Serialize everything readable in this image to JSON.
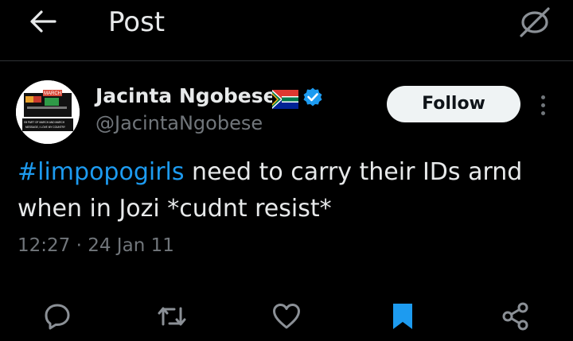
{
  "header": {
    "title": "Post",
    "back_icon": "arrow-left-icon",
    "grok_icon": "grok-icon"
  },
  "author": {
    "name": "Jacinta Ngobese",
    "handle": "@JacintaNgobese",
    "flag_icon": "south-africa-flag-icon",
    "verified_icon": "verified-badge-icon",
    "verified_color": "#1d9bf0",
    "avatar": {
      "logo_text": "MARCH",
      "tagline_1": "I'M PART OF MARCH AND MARCH",
      "tagline_2": "MESSAGE, I LOVE MY COUNTRY"
    }
  },
  "follow_label": "Follow",
  "tweet": {
    "hashtag": "#limpopogirls",
    "text": " need to carry their IDs arnd when in Jozi *cudnt resist*",
    "time": "12:27",
    "separator": " · ",
    "date": "24 Jan 11"
  },
  "actions": {
    "reply_icon": "reply-icon",
    "repost_icon": "repost-icon",
    "like_icon": "heart-icon",
    "bookmark_icon": "bookmark-icon",
    "share_icon": "share-icon",
    "bookmark_color": "#1d9bf0"
  },
  "colors": {
    "background": "#000000",
    "text": "#e7e9ea",
    "secondary": "#71767b",
    "accent": "#1d9bf0"
  }
}
